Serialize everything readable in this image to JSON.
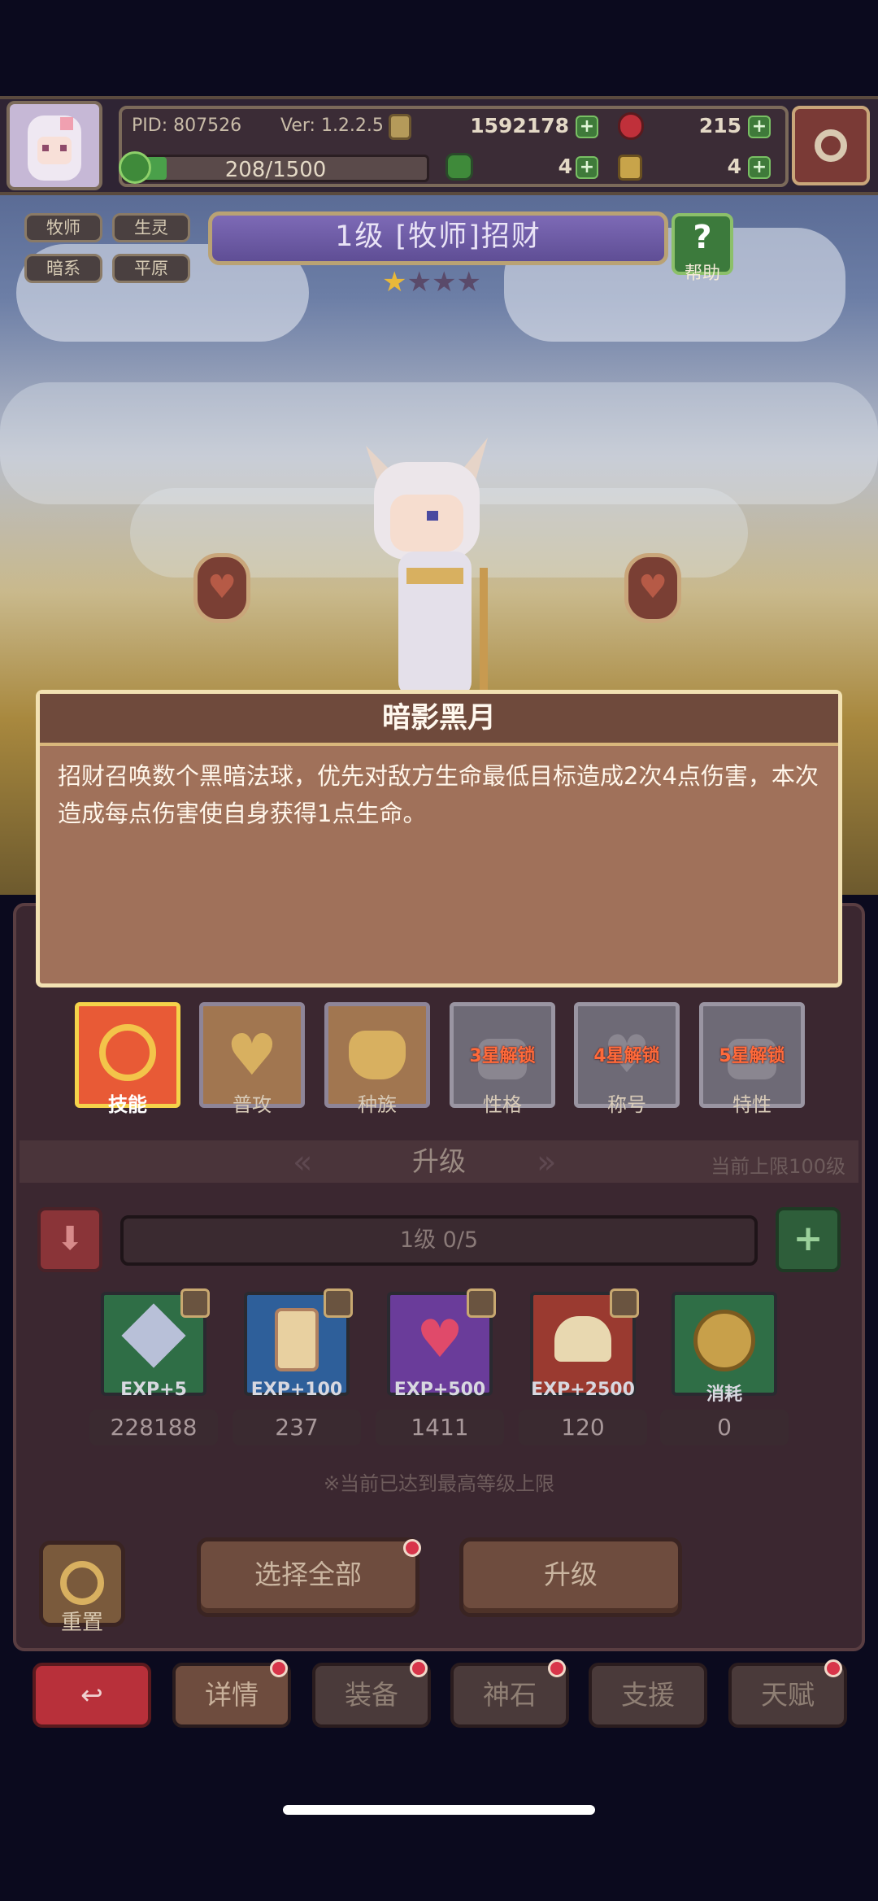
{
  "hud": {
    "pid": "PID: 807526",
    "version": "Ver: 1.2.2.5",
    "gold": "1592178",
    "gems": "215",
    "exp_bar": "208/1500",
    "exp_fraction": 0.139,
    "clover_count": "4",
    "key_count": "4"
  },
  "tags": [
    "牧师",
    "生灵",
    "暗系",
    "平原"
  ],
  "hero": {
    "title": "1级 [牧师]招财",
    "stars_filled": 1,
    "stars_total": 4,
    "help_label": "帮助"
  },
  "popup": {
    "title": "暗影黑月",
    "description": "招财召唤数个黑暗法球，优先对敌方生命最低目标造成2次4点伤害，本次造成每点伤害使自身获得1点生命。"
  },
  "skill_tabs": [
    {
      "label": "技能",
      "lock": ""
    },
    {
      "label": "普攻",
      "lock": ""
    },
    {
      "label": "种族",
      "lock": ""
    },
    {
      "label": "性格",
      "lock": "3星解锁"
    },
    {
      "label": "称号",
      "lock": "4星解锁"
    },
    {
      "label": "特性",
      "lock": "5星解锁"
    }
  ],
  "upgrade": {
    "section_title": "升级",
    "limit_note": "当前上限100级",
    "level_bar": "1级 0/5",
    "items": [
      {
        "label": "EXP+5",
        "count": "228188",
        "color": "#2f6e46"
      },
      {
        "label": "EXP+100",
        "count": "237",
        "color": "#2e5f9a"
      },
      {
        "label": "EXP+500",
        "count": "1411",
        "color": "#6a3c9a"
      },
      {
        "label": "EXP+2500",
        "count": "120",
        "color": "#9a3a30"
      },
      {
        "label": "消耗",
        "count": "0",
        "color": "#2f6e46"
      }
    ],
    "max_notice": "※当前已达到最高等级上限",
    "reset_label": "重置",
    "select_all_label": "选择全部",
    "upgrade_label": "升级"
  },
  "bottom_nav": {
    "details": "详情",
    "equip": "装备",
    "god_stone": "神石",
    "support": "支援",
    "talent": "天赋"
  }
}
